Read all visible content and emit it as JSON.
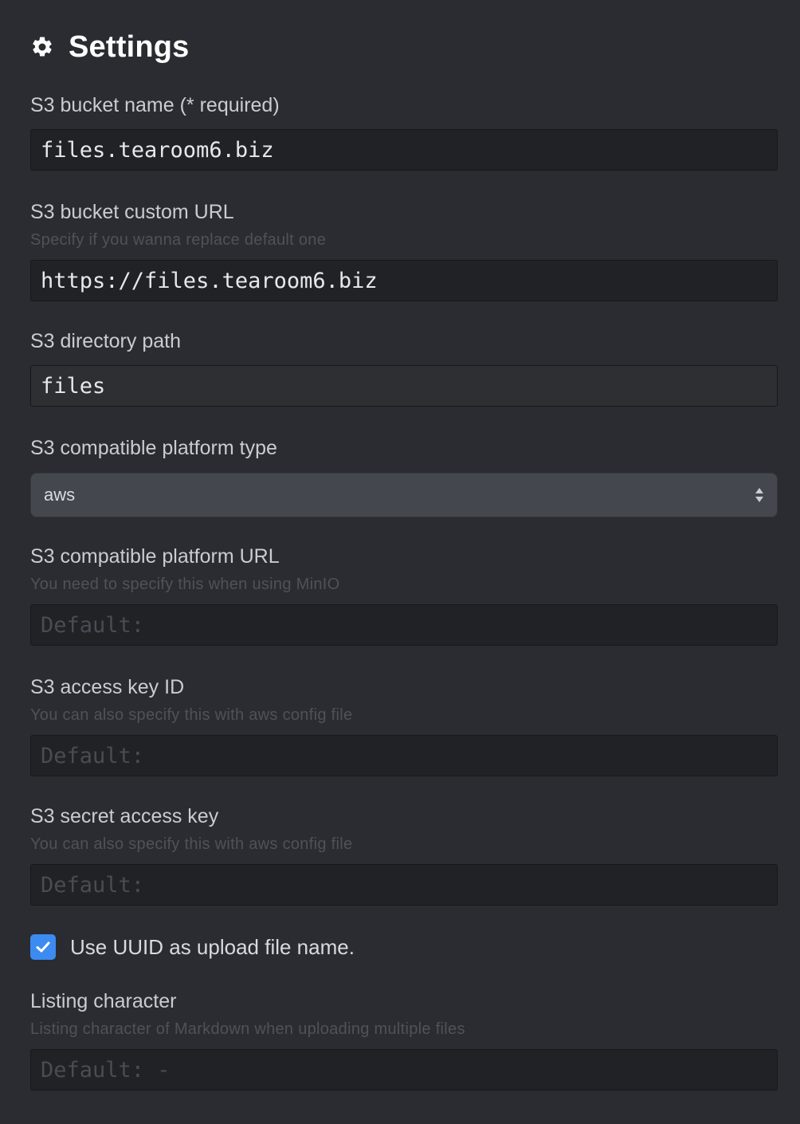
{
  "header": {
    "icon": "gear-icon",
    "title": "Settings"
  },
  "bucket_name": {
    "label": "S3 bucket name (* required)",
    "value": "files.tearoom6.biz"
  },
  "bucket_url": {
    "label": "S3 bucket custom URL",
    "hint": "Specify if you wanna replace default one",
    "value": "https://files.tearoom6.biz"
  },
  "directory_path": {
    "label": "S3 directory path",
    "value": "files"
  },
  "platform_type": {
    "label": "S3 compatible platform type",
    "selected": "aws"
  },
  "platform_url": {
    "label": "S3 compatible platform URL",
    "hint": "You need to specify this when using MinIO",
    "placeholder": "Default:"
  },
  "access_key_id": {
    "label": "S3 access key ID",
    "hint": "You can also specify this with aws config file",
    "placeholder": "Default:"
  },
  "secret_access_key": {
    "label": "S3 secret access key",
    "hint": "You can also specify this with aws config file",
    "placeholder": "Default:"
  },
  "uuid_option": {
    "label": "Use UUID as upload file name.",
    "checked": true
  },
  "listing_character": {
    "label": "Listing character",
    "hint": "Listing character of Markdown when uploading multiple files",
    "placeholder": "Default: -"
  },
  "colors": {
    "background": "#2a2c31",
    "checkbox_accent": "#3b8bf1"
  }
}
